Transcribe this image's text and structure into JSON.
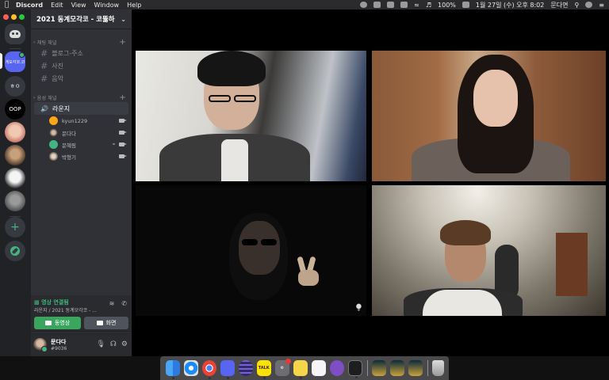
{
  "menubar": {
    "app_name": "Discord",
    "items": [
      "Edit",
      "View",
      "Window",
      "Help"
    ],
    "battery": "100%",
    "datetime": "1월 27일 (수) 오후 8:02",
    "user": "문다면"
  },
  "servers": {
    "active_label": "게모각코.코",
    "item2_label": "ㅎㅇ",
    "item3_label": "OOP"
  },
  "guild": {
    "name": "2021 동계모각코 - 코뚫하",
    "text_category": "채팅 채널",
    "text_channels": [
      "블로그-주소",
      "사진",
      "음악"
    ],
    "voice_category": "음성 채널",
    "voice_channel": "라운지",
    "voice_users": [
      "kyun1229",
      "문다다",
      "문혜림",
      "박형기"
    ]
  },
  "voice_panel": {
    "status": "영상 연결됨",
    "subtitle": "라운지 / 2021 동계모각코 - ...",
    "video_button": "동영상",
    "screen_button": "화면"
  },
  "user_panel": {
    "name": "문다다",
    "tag": "#9036"
  },
  "dock": {
    "talk_label": "TALK"
  },
  "colors": {
    "accent": "#5865f2",
    "online": "#43b581",
    "video_button": "#3ba55d"
  }
}
